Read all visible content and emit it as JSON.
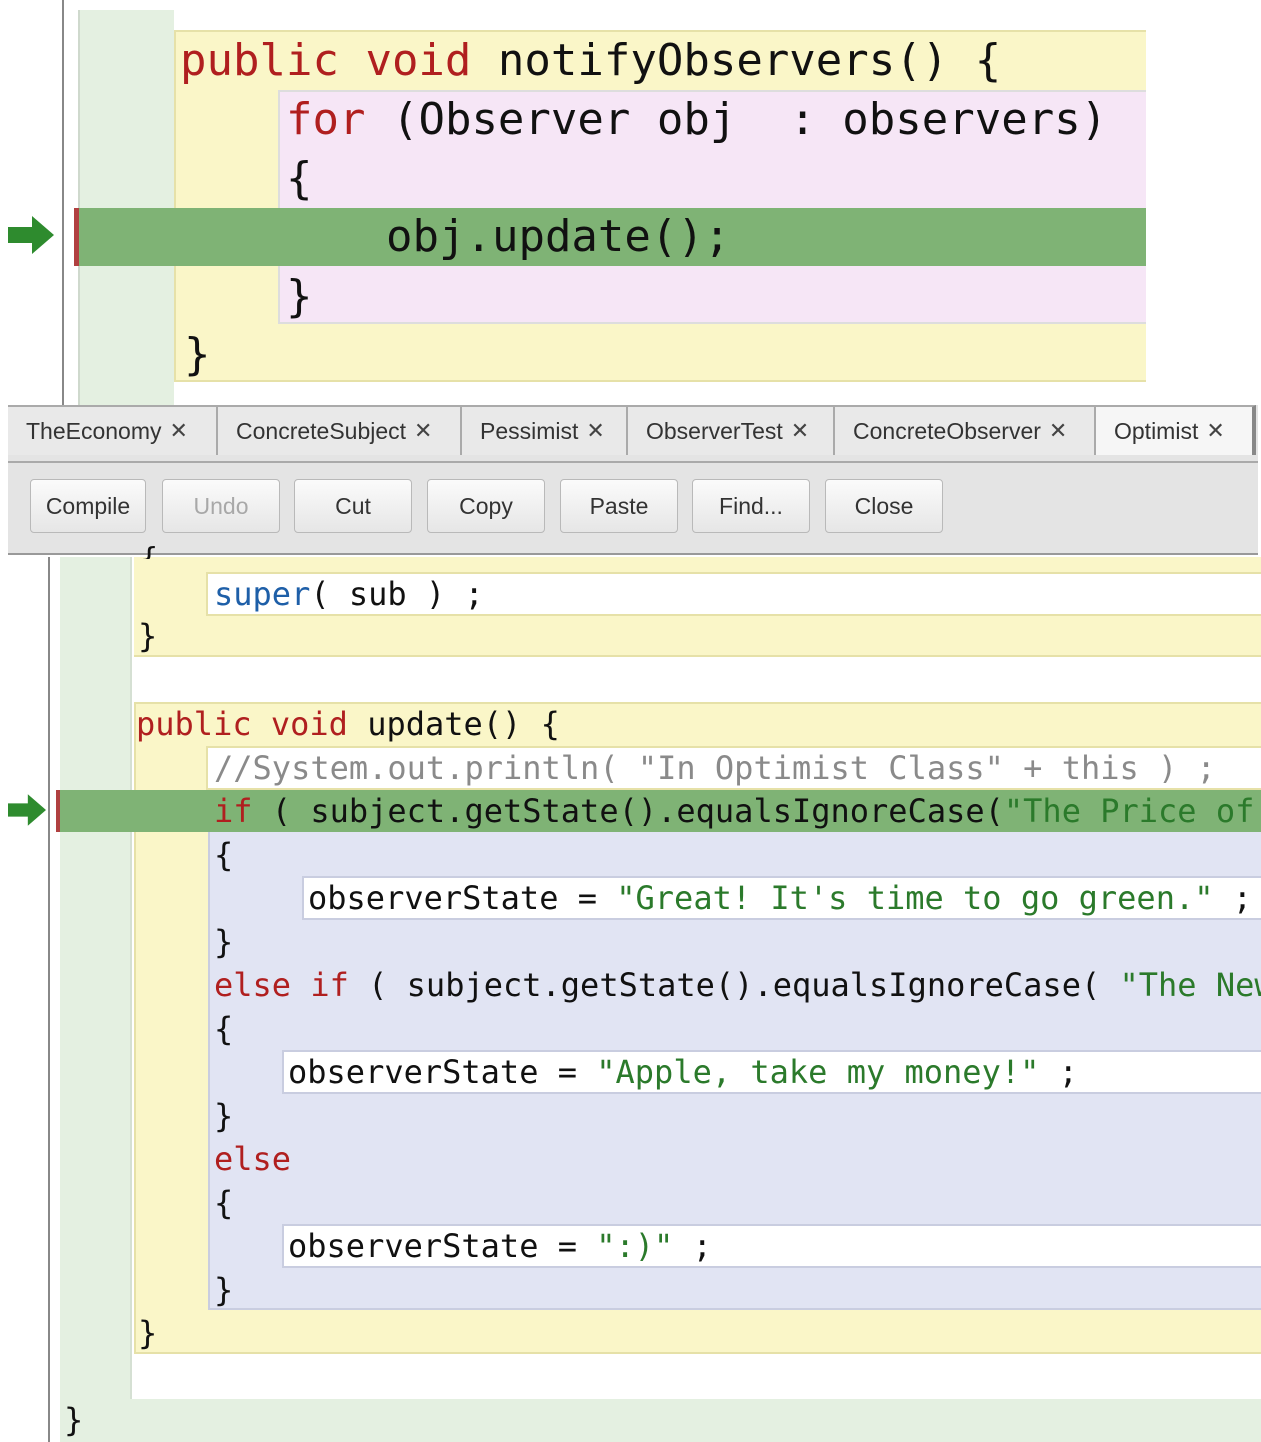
{
  "top_editor": {
    "line1": {
      "kw1": "public",
      "kw2": "void",
      "rest": " notifyObservers() {"
    },
    "line2": {
      "kw": "for",
      "rest": " (Observer obj  : observers)"
    },
    "line3": "{",
    "line4": "obj.update();",
    "line5": "}",
    "line6": "}"
  },
  "tabs": [
    {
      "label": "TheEconomy"
    },
    {
      "label": "ConcreteSubject"
    },
    {
      "label": "Pessimist"
    },
    {
      "label": "ObserverTest"
    },
    {
      "label": "ConcreteObserver"
    },
    {
      "label": "Optimist"
    }
  ],
  "tab_close_glyph": "✕",
  "toolbar": {
    "compile": "Compile",
    "undo": "Undo",
    "cut": "Cut",
    "copy": "Copy",
    "paste": "Paste",
    "find": "Find...",
    "close": "Close"
  },
  "bottom_editor": {
    "partial_brace": "{",
    "super_kw": "super",
    "super_rest": "( sub ) ;",
    "close1": "}",
    "update_kw1": "public",
    "update_kw2": "void",
    "update_rest": " update() {",
    "comment": "//System.out.println( \"In Optimist Class\" + this ) ;",
    "if_kw": "if",
    "if_rest": " ( subject.getState().equalsIgnoreCase(",
    "if_str": "\"The Price of",
    "brace_open1": "{",
    "assign1_pre": "observerState = ",
    "assign1_str": "\"Great! It's time to go green.\"",
    "assign1_post": " ;",
    "brace_close1": "}",
    "elseif_kw": "else if",
    "elseif_rest": " ( subject.getState().equalsIgnoreCase( ",
    "elseif_str": "\"The New",
    "brace_open2": "{",
    "assign2_pre": "observerState = ",
    "assign2_str": "\"Apple, take my money!\"",
    "assign2_post": " ;",
    "brace_close2": "}",
    "else_kw": "else",
    "brace_open3": "{",
    "assign3_pre": "observerState = ",
    "assign3_str": "\":)\"",
    "assign3_post": " ;",
    "brace_close3": "}",
    "method_close": "}",
    "class_close": "}"
  },
  "colors": {
    "method_bg": "#faf6c8",
    "loop_bg": "#f6e6f6",
    "if_bg": "#e1e4f3",
    "class_bg": "#e4f0e1",
    "highlight": "#7fb375",
    "keyword": "#b01f1f",
    "string": "#2b7a2b"
  },
  "icons": {
    "breakpoint_arrow": "green-arrow-icon"
  }
}
